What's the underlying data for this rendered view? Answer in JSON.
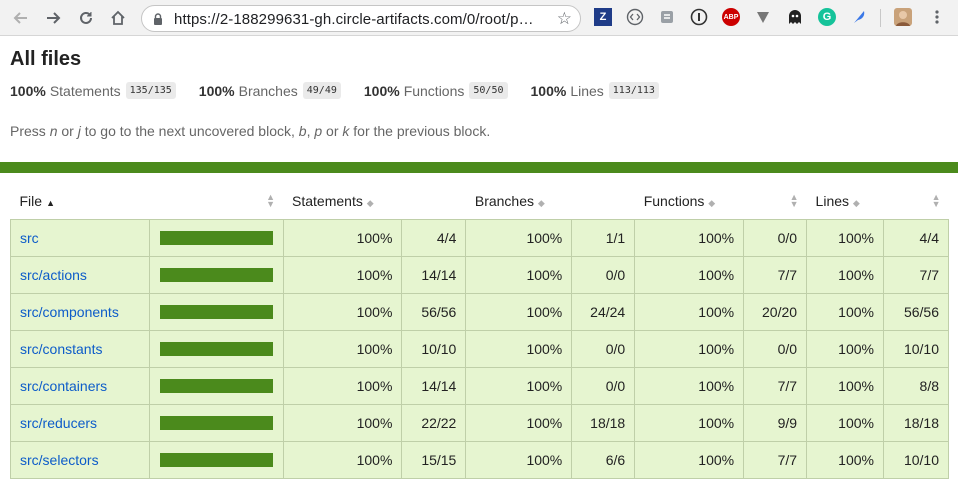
{
  "browser": {
    "url": "https://2-188299631-gh.circle-artifacts.com/0/root/p…",
    "extensions": [
      "zotero-icon",
      "code-icon",
      "reader-icon",
      "info-icon",
      "adblock-icon",
      "vimium-icon",
      "ghost-icon",
      "grammarly-icon",
      "feather-icon",
      "avatar",
      "menu-icon"
    ],
    "abp_label": "ABP",
    "z_label": "Z",
    "g_label": "G"
  },
  "page": {
    "title": "All files",
    "summary": [
      {
        "pct": "100%",
        "label": "Statements",
        "fraction": "135/135"
      },
      {
        "pct": "100%",
        "label": "Branches",
        "fraction": "49/49"
      },
      {
        "pct": "100%",
        "label": "Functions",
        "fraction": "50/50"
      },
      {
        "pct": "100%",
        "label": "Lines",
        "fraction": "113/113"
      }
    ],
    "hint": {
      "p1": "Press ",
      "k1": "n",
      "p2": " or ",
      "k2": "j",
      "p3": " to go to the next uncovered block, ",
      "k3": "b",
      "p4": ", ",
      "k4": "p",
      "p5": " or ",
      "k5": "k",
      "p6": " for the previous block."
    },
    "status_color": "#4b8a1c"
  },
  "table": {
    "headers": {
      "file": "File",
      "statements": "Statements",
      "branches": "Branches",
      "functions": "Functions",
      "lines": "Lines"
    },
    "rows": [
      {
        "file": "src",
        "coverage": 1.0,
        "st_pct": "100%",
        "st": "4/4",
        "br_pct": "100%",
        "br": "1/1",
        "fn_pct": "100%",
        "fn": "0/0",
        "ln_pct": "100%",
        "ln": "4/4"
      },
      {
        "file": "src/actions",
        "coverage": 1.0,
        "st_pct": "100%",
        "st": "14/14",
        "br_pct": "100%",
        "br": "0/0",
        "fn_pct": "100%",
        "fn": "7/7",
        "ln_pct": "100%",
        "ln": "7/7"
      },
      {
        "file": "src/components",
        "coverage": 1.0,
        "st_pct": "100%",
        "st": "56/56",
        "br_pct": "100%",
        "br": "24/24",
        "fn_pct": "100%",
        "fn": "20/20",
        "ln_pct": "100%",
        "ln": "56/56"
      },
      {
        "file": "src/constants",
        "coverage": 1.0,
        "st_pct": "100%",
        "st": "10/10",
        "br_pct": "100%",
        "br": "0/0",
        "fn_pct": "100%",
        "fn": "0/0",
        "ln_pct": "100%",
        "ln": "10/10"
      },
      {
        "file": "src/containers",
        "coverage": 1.0,
        "st_pct": "100%",
        "st": "14/14",
        "br_pct": "100%",
        "br": "0/0",
        "fn_pct": "100%",
        "fn": "7/7",
        "ln_pct": "100%",
        "ln": "8/8"
      },
      {
        "file": "src/reducers",
        "coverage": 1.0,
        "st_pct": "100%",
        "st": "22/22",
        "br_pct": "100%",
        "br": "18/18",
        "fn_pct": "100%",
        "fn": "9/9",
        "ln_pct": "100%",
        "ln": "18/18"
      },
      {
        "file": "src/selectors",
        "coverage": 1.0,
        "st_pct": "100%",
        "st": "15/15",
        "br_pct": "100%",
        "br": "6/6",
        "fn_pct": "100%",
        "fn": "7/7",
        "ln_pct": "100%",
        "ln": "10/10"
      }
    ]
  }
}
